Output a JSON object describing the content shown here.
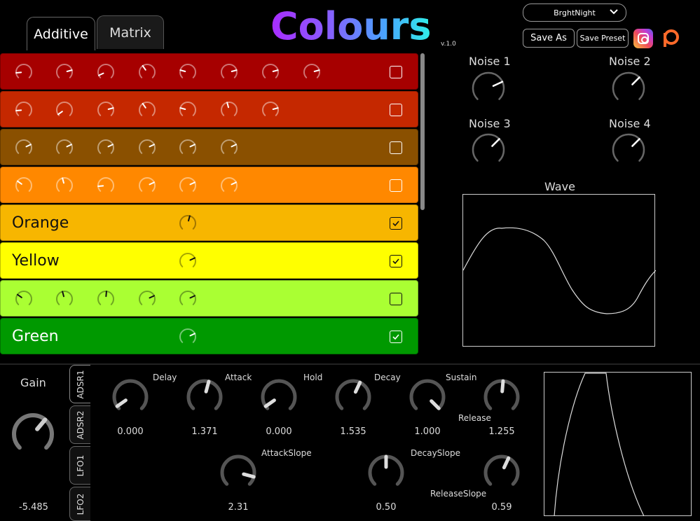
{
  "tabs": [
    {
      "label": "Additive",
      "active": true
    },
    {
      "label": "Matrix",
      "active": false
    }
  ],
  "logo": {
    "text": "Colours",
    "version": "v.1.0"
  },
  "preset": {
    "selected": "BrghtNight"
  },
  "buttons": {
    "save_as": "Save As",
    "save_preset": "Save Preset"
  },
  "colours": {
    "row_colors": [
      "#a60000",
      "#c52800",
      "#8a5000",
      "#ff8800",
      "#f7b600",
      "#ffff00",
      "#aaff33",
      "#009900"
    ]
  },
  "rows": [
    {
      "label": "",
      "color": "#a60000",
      "checked": false,
      "knob_count": 8
    },
    {
      "label": "",
      "color": "#c52800",
      "checked": false,
      "knob_count": 7
    },
    {
      "label": "",
      "color": "#8a5000",
      "checked": false,
      "knob_count": 6
    },
    {
      "label": "",
      "color": "#ff8800",
      "checked": false,
      "knob_count": 6
    },
    {
      "label": "Orange",
      "color": "#f7b600",
      "checked": true,
      "knob_count": 1
    },
    {
      "label": "Yellow",
      "color": "#ffff00",
      "checked": true,
      "knob_count": 1
    },
    {
      "label": "",
      "color": "#aaff33",
      "checked": false,
      "knob_count": 5
    },
    {
      "label": "Green",
      "color": "#009900",
      "checked": true,
      "knob_count": 1
    }
  ],
  "noise": {
    "n1": "Noise 1",
    "n2": "Noise 2",
    "n3": "Noise 3",
    "n4": "Noise 4"
  },
  "wave": {
    "label": "Wave"
  },
  "gain": {
    "label": "Gain",
    "value": "-5.485"
  },
  "side_tabs": [
    "ADSR1",
    "ADSR2",
    "LFO1",
    "LFO2"
  ],
  "envelope": {
    "delay": {
      "label": "Delay",
      "value": "0.000"
    },
    "attack": {
      "label": "Attack",
      "value": "1.371"
    },
    "hold": {
      "label": "Hold",
      "value": "0.000"
    },
    "decay": {
      "label": "Decay",
      "value": "1.535"
    },
    "sustain": {
      "label": "Sustain",
      "value": "1.000"
    },
    "release": {
      "label": "Release",
      "value": "1.255"
    },
    "attack_slope": {
      "label": "AttackSlope",
      "value": "2.31"
    },
    "decay_slope": {
      "label": "DecaySlope",
      "value": "0.50"
    },
    "release_slope": {
      "label": "ReleaseSlope",
      "value": "0.59"
    }
  }
}
